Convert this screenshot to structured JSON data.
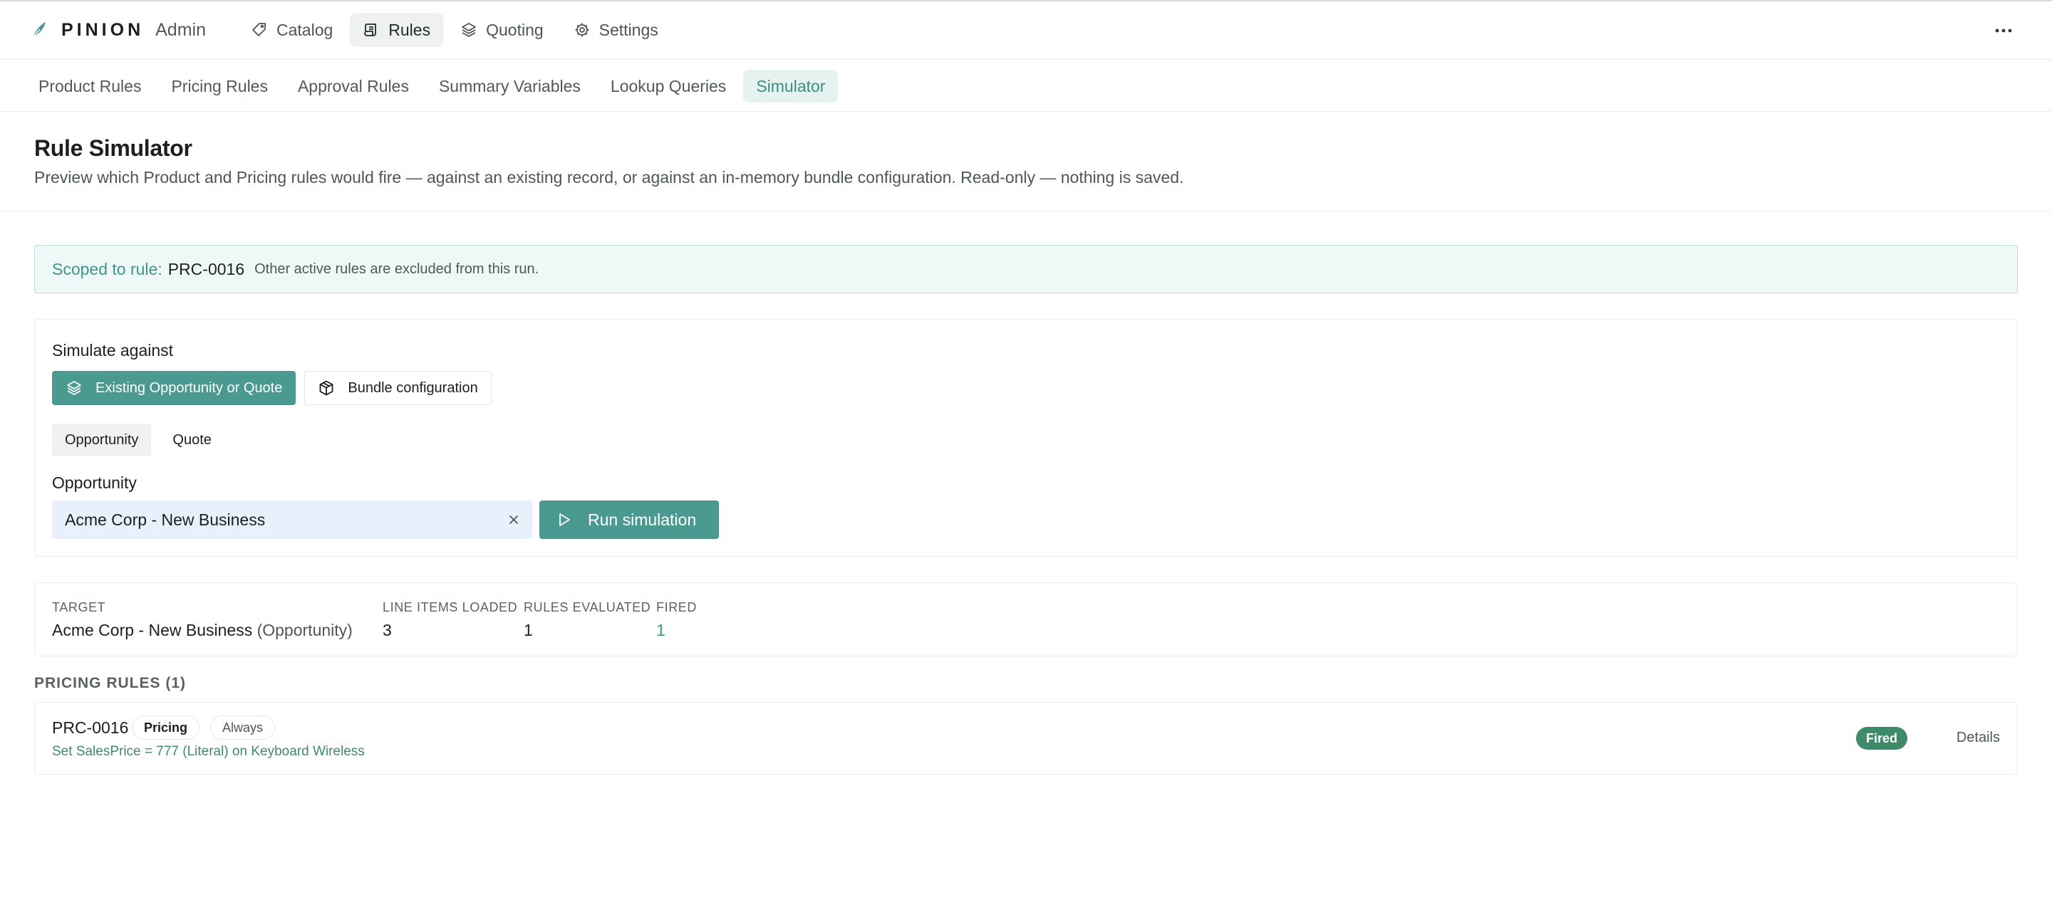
{
  "brand": {
    "name": "PINION",
    "suffix": "Admin"
  },
  "nav": {
    "items": [
      {
        "label": "Catalog",
        "icon": "tag-icon"
      },
      {
        "label": "Rules",
        "icon": "scroll-icon",
        "active": true
      },
      {
        "label": "Quoting",
        "icon": "layers-icon"
      },
      {
        "label": "Settings",
        "icon": "gear-icon"
      }
    ],
    "more_icon": "more-horizontal-icon"
  },
  "subtabs": [
    {
      "label": "Product Rules"
    },
    {
      "label": "Pricing Rules"
    },
    {
      "label": "Approval Rules"
    },
    {
      "label": "Summary Variables"
    },
    {
      "label": "Lookup Queries"
    },
    {
      "label": "Simulator",
      "active": true
    }
  ],
  "page": {
    "title": "Rule Simulator",
    "description": "Preview which Product and Pricing rules would fire — against an existing record, or against an in-memory bundle configuration. Read-only — nothing is saved."
  },
  "scope": {
    "label": "Scoped to rule:",
    "rule_id": "PRC-0016",
    "note": "Other active rules are excluded from this run."
  },
  "simulate": {
    "label": "Simulate against",
    "modes": [
      {
        "label": "Existing Opportunity or Quote",
        "icon": "layers-icon",
        "active": true
      },
      {
        "label": "Bundle configuration",
        "icon": "box-icon",
        "active": false
      }
    ],
    "record_types": [
      {
        "label": "Opportunity",
        "active": true
      },
      {
        "label": "Quote",
        "active": false
      }
    ],
    "field_label": "Opportunity",
    "field_value": "Acme Corp - New Business",
    "run_label": "Run simulation"
  },
  "summary": {
    "target_label": "TARGET",
    "target_value": "Acme Corp - New Business",
    "target_type": "(Opportunity)",
    "line_items_label": "LINE ITEMS LOADED",
    "line_items_value": "3",
    "rules_evaluated_label": "RULES EVALUATED",
    "rules_evaluated_value": "1",
    "fired_label": "FIRED",
    "fired_value": "1"
  },
  "pricing_section": {
    "title": "PRICING RULES (1)"
  },
  "rules": [
    {
      "id": "PRC-0016",
      "type_tag": "Pricing",
      "trigger_tag": "Always",
      "action": "Set SalesPrice = 777 (Literal) on Keyboard Wireless",
      "status": "Fired",
      "details_label": "Details"
    }
  ],
  "colors": {
    "accent": "#4a9a92",
    "accent_light": "#e5f2f0",
    "fired_green": "#3f8a6a",
    "input_bg": "#e8f0fc"
  }
}
